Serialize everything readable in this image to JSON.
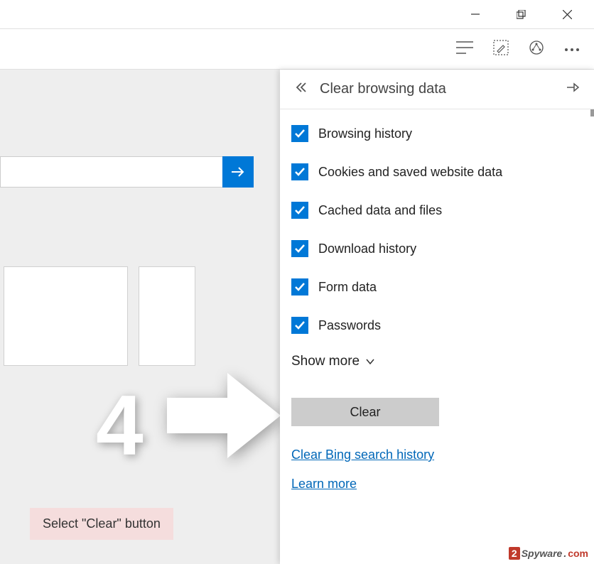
{
  "panel": {
    "title": "Clear browsing data",
    "items": [
      "Browsing history",
      "Cookies and saved website data",
      "Cached data and files",
      "Download history",
      "Form data",
      "Passwords"
    ],
    "show_more": "Show more",
    "clear_button": "Clear",
    "link_bing": "Clear Bing search history",
    "link_learn": "Learn more"
  },
  "annotation": {
    "step": "4",
    "caption": "Select \"Clear\" button"
  },
  "watermark": {
    "two": "2",
    "name": "Spyware",
    "dot": ".",
    "com": "com"
  }
}
